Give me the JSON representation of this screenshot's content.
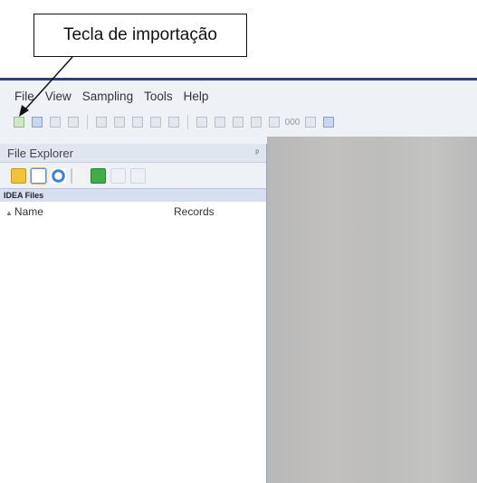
{
  "callout": {
    "label": "Tecla de importação"
  },
  "menu": {
    "items": [
      "File",
      "View",
      "Sampling",
      "Tools",
      "Help"
    ]
  },
  "toolbar": {
    "import_icon": "import-file-icon",
    "number_format_label": "000"
  },
  "explorer": {
    "title": "File Explorer",
    "section": "IDEA Files",
    "columns": {
      "name": "Name",
      "records": "Records"
    }
  },
  "colors": {
    "window_border": "#2f3f7a",
    "workspace": "#bebdbd",
    "pane_header": "#dfe6f0"
  }
}
